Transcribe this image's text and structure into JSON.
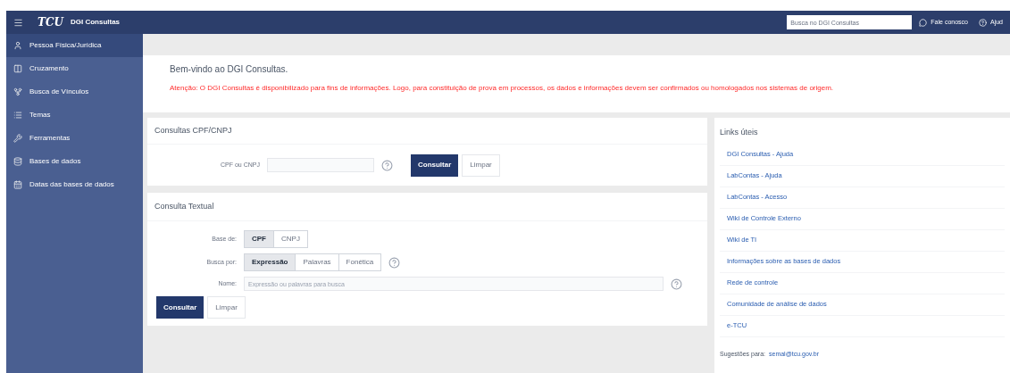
{
  "header": {
    "brand_logo": "TCU",
    "app_name": "DGI Consultas",
    "search": {
      "placeholder": "Busca no DGI Consultas"
    },
    "links": [
      "Fale conosco",
      "Ajud"
    ]
  },
  "sidebar": {
    "items": [
      {
        "label": "Pessoa Física/Jurídica",
        "selected": true
      },
      {
        "label": "Cruzamento",
        "selected": false
      },
      {
        "label": "Busca de Vínculos",
        "selected": false
      },
      {
        "label": "Temas",
        "selected": false
      },
      {
        "label": "Ferramentas",
        "selected": false
      },
      {
        "label": "Bases de dados",
        "selected": false
      },
      {
        "label": "Datas das bases de dados",
        "selected": false
      }
    ]
  },
  "welcome": {
    "title": "Bem-vindo ao DGI Consultas.",
    "warning": "Atenção: O DGI Consultas é disponibilizado para fins de informações. Logo, para constituição de prova em processos, os dados e informações devem ser confirmados ou homologados nos sistemas de origem."
  },
  "cpf_panel": {
    "title": "Consultas CPF/CNPJ",
    "field_label": "CPF ou CNPJ",
    "buttons": [
      "Consultar",
      "Limpar"
    ]
  },
  "text_panel": {
    "title": "Consulta Textual",
    "base_label": "Base de:",
    "base_options": [
      {
        "label": "CPF",
        "selected": true
      },
      {
        "label": "CNPJ",
        "selected": false
      }
    ],
    "search_label": "Busca por:",
    "search_options": [
      {
        "label": "Expressão",
        "selected": true
      },
      {
        "label": "Palavras",
        "selected": false
      },
      {
        "label": "Fonética",
        "selected": false
      }
    ],
    "name_label": "Nome:",
    "name_placeholder": "Expressão ou palavras para busca",
    "buttons": [
      "Consultar",
      "Limpar"
    ]
  },
  "links_panel": {
    "title": "Links úteis",
    "links": [
      "DGI Consultas - Ajuda",
      "LabContas - Ajuda",
      "LabContas - Acesso",
      "Wiki de Controle Externo",
      "Wiki de TI",
      "Informações sobre as bases de dados",
      "Rede de controle",
      "Comunidade de análise de dados",
      "e-TCU"
    ],
    "suggestion_label": "Sugestões para:",
    "suggestion_email": "semal@tcu.gov.br"
  }
}
